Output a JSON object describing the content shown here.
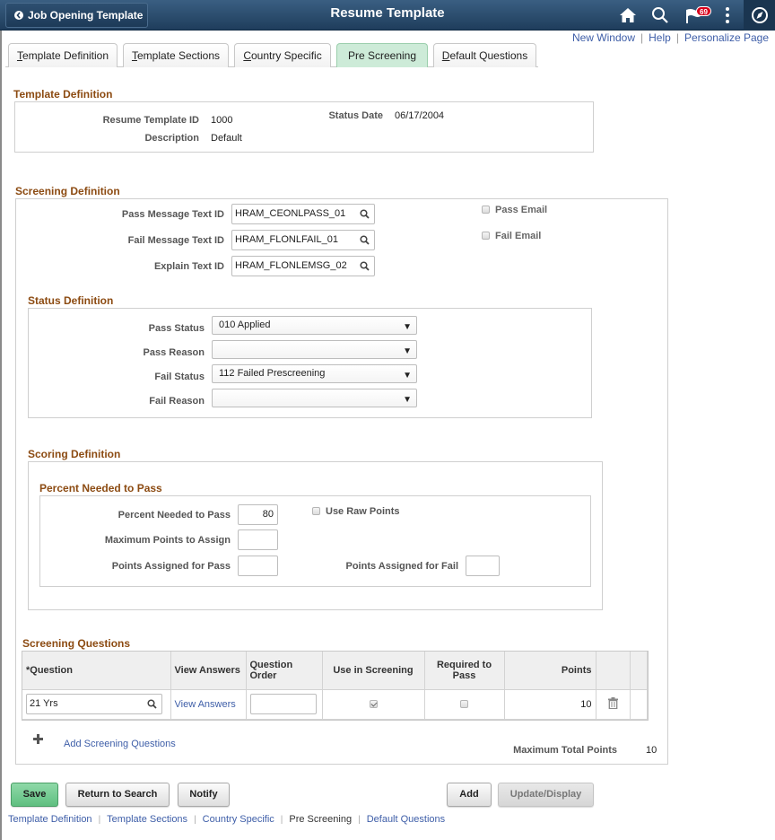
{
  "header": {
    "back_label": "Job Opening Template",
    "title": "Resume Template",
    "notification_count": "69",
    "icons": [
      "home-icon",
      "search-icon",
      "flag-icon",
      "more-icon",
      "navbar-compass-icon"
    ]
  },
  "toplinks": {
    "new_window": "New Window",
    "help": "Help",
    "personalize": "Personalize Page",
    "separator": "|"
  },
  "tabs": [
    {
      "label_key": "T",
      "label_rest": "emplate Definition",
      "active": false
    },
    {
      "label_key": "T",
      "label_rest": "emplate Sections",
      "active": false
    },
    {
      "label_key": "C",
      "label_rest": "ountry Specific",
      "active": false
    },
    {
      "label_key": "",
      "label_rest": "Pre Screening",
      "active": true
    },
    {
      "label_key": "D",
      "label_rest": "efault Questions",
      "active": false
    }
  ],
  "template_definition": {
    "title": "Template Definition",
    "resume_template_id_label": "Resume Template ID",
    "resume_template_id": "1000",
    "description_label": "Description",
    "description": "Default",
    "status_date_label": "Status Date",
    "status_date": "06/17/2004"
  },
  "screening_definition": {
    "title": "Screening Definition",
    "pass_message_label": "Pass Message Text ID",
    "pass_message_value": "HRAM_CEONLPASS_01",
    "fail_message_label": "Fail Message Text ID",
    "fail_message_value": "HRAM_FLONLFAIL_01",
    "explain_text_label": "Explain Text ID",
    "explain_text_value": "HRAM_FLONLEMSG_02",
    "pass_email_label": "Pass Email",
    "pass_email_checked": false,
    "fail_email_label": "Fail Email",
    "fail_email_checked": false
  },
  "status_definition": {
    "title": "Status Definition",
    "pass_status_label": "Pass Status",
    "pass_status_value": "010 Applied",
    "pass_reason_label": "Pass Reason",
    "pass_reason_value": "",
    "fail_status_label": "Fail Status",
    "fail_status_value": "112 Failed Prescreening",
    "fail_reason_label": "Fail Reason",
    "fail_reason_value": ""
  },
  "scoring_definition": {
    "title": "Scoring Definition",
    "subtitle": "Percent Needed to Pass",
    "percent_label": "Percent Needed to Pass",
    "percent_value": "80",
    "max_points_label": "Maximum Points to Assign",
    "max_points_value": "",
    "points_pass_label": "Points Assigned for Pass",
    "points_pass_value": "",
    "points_fail_label": "Points Assigned for Fail",
    "points_fail_value": "",
    "use_raw_points_label": "Use Raw Points",
    "use_raw_points_checked": false
  },
  "screening_questions": {
    "title": "Screening Questions",
    "columns": [
      "*Question",
      "View Answers",
      "Question Order",
      "Use in Screening",
      "Required to Pass",
      "Points"
    ],
    "rows": [
      {
        "question": "21 Yrs",
        "view_answers": "View Answers",
        "question_order": "",
        "use_in_screening": true,
        "required_to_pass": false,
        "points": "10"
      }
    ],
    "add_label": "Add Screening Questions",
    "max_total_label": "Maximum Total Points",
    "max_total_value": "10"
  },
  "buttons": {
    "save": "Save",
    "return_to_search": "Return to Search",
    "notify": "Notify",
    "add": "Add",
    "update_display": "Update/Display"
  },
  "bottom_links": [
    "Template Definition",
    "Template Sections",
    "Country Specific",
    "Pre Screening",
    "Default Questions"
  ],
  "bottom_current": "Pre Screening",
  "colors": {
    "header_bg": "#2a4a6b",
    "section_title": "#8c4b12",
    "link": "#3e5ea8",
    "active_tab": "#cdebd8",
    "primary_button": "#6fca8e",
    "badge": "#d9001b"
  }
}
